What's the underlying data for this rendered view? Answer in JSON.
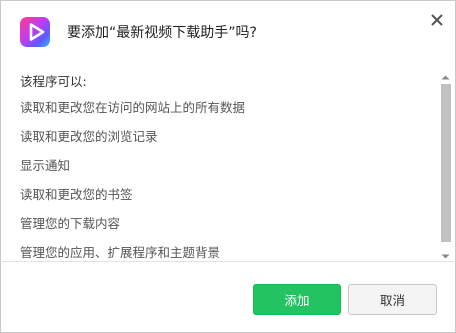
{
  "dialog": {
    "title": "要添加“最新视频下载助手”吗?",
    "app_icon": "play-app-icon",
    "close_icon": "close-icon"
  },
  "permissions": {
    "heading": "该程序可以:",
    "items": [
      "读取和更改您在访问的网站上的所有数据",
      "读取和更改您的浏览记录",
      "显示通知",
      "读取和更改您的书签",
      "管理您的下载内容",
      "管理您的应用、扩展程序和主题背景"
    ]
  },
  "actions": {
    "add_label": "添加",
    "cancel_label": "取消"
  },
  "colors": {
    "accent_green": "#23c362",
    "scrollbar_thumb": "#c1c1c1"
  }
}
